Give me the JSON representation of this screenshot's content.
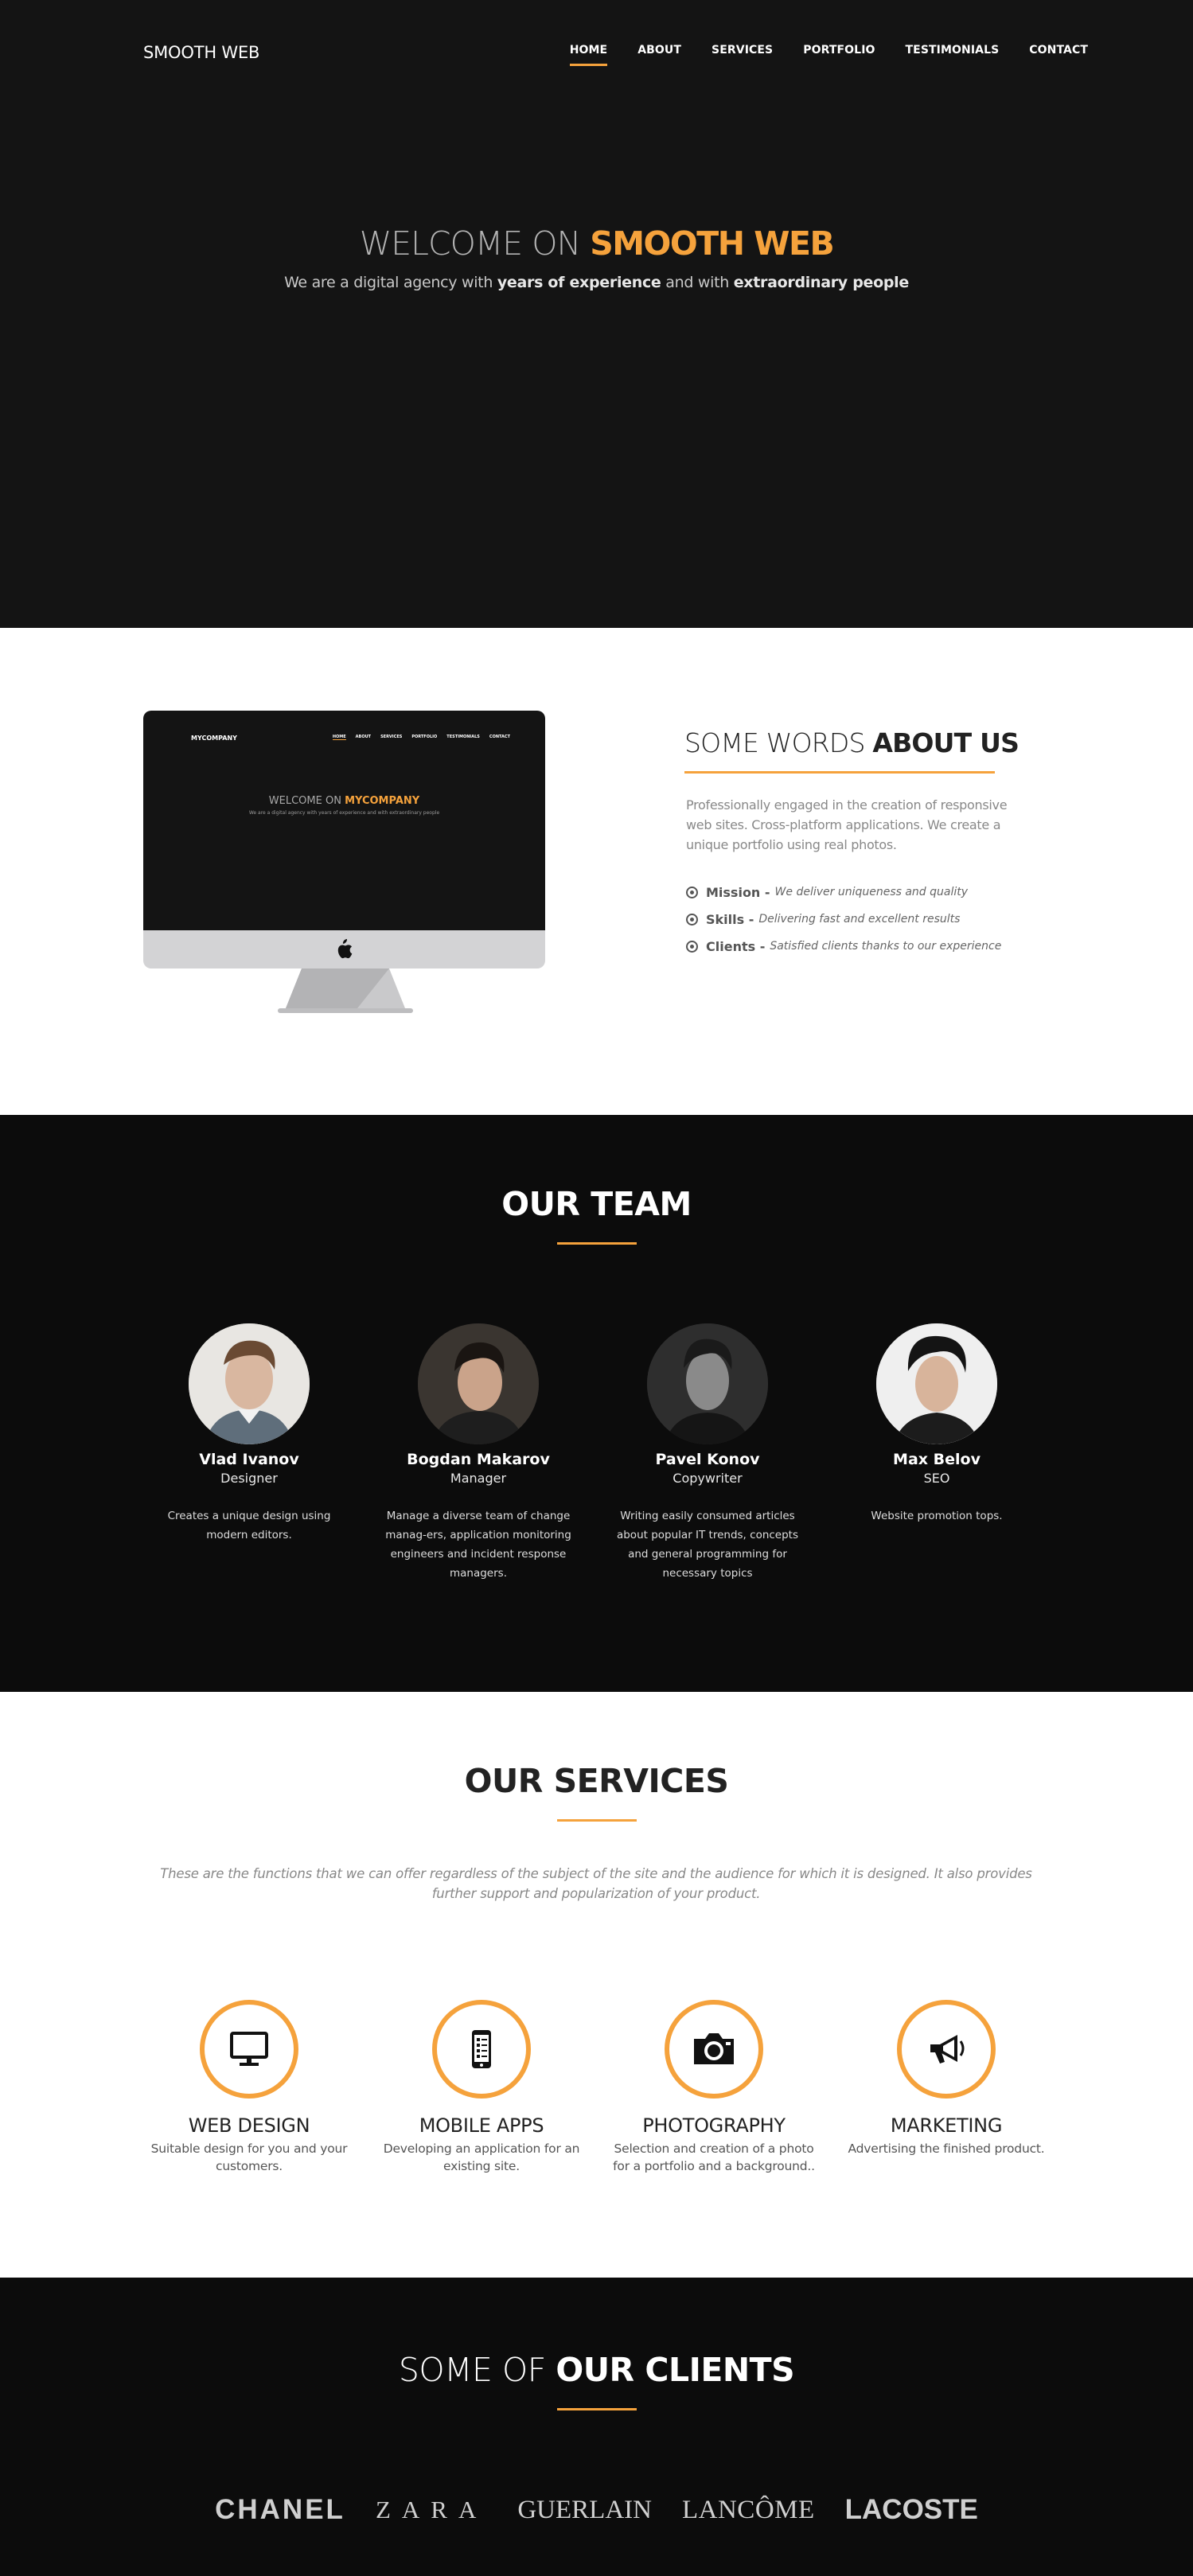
{
  "nav": {
    "logo": "SMOOTH WEB",
    "items": [
      {
        "label": "HOME",
        "active": true
      },
      {
        "label": "ABOUT",
        "active": false
      },
      {
        "label": "SERVICES",
        "active": false
      },
      {
        "label": "PORTFOLIO",
        "active": false
      },
      {
        "label": "TESTIMONIALS",
        "active": false
      },
      {
        "label": "CONTACT",
        "active": false
      }
    ]
  },
  "hero": {
    "title_pre": "WELCOME ON ",
    "title_accent": "SMOOTH WEB",
    "sub_1": "We are a digital agency with ",
    "sub_b1": "years of experience",
    "sub_2": " and with ",
    "sub_b2": "extraordinary people"
  },
  "about": {
    "mockup": {
      "logo": "MYCOMPANY",
      "menu": [
        "HOME",
        "ABOUT",
        "SERVICES",
        "PORTFOLIO",
        "TESTIMONIALS",
        "CONTACT"
      ],
      "title_pre": "WELCOME ON ",
      "title_accent": "MYCOMPANY",
      "sub": "We are a digital agency with years of experience and with extraordinary people"
    },
    "title_pre": "SOME WORDS ",
    "title_bold": "ABOUT US",
    "text": "Professionally engaged in the creation of responsive web sites. Cross-platform applications. We create a unique portfolio using real photos.",
    "list": [
      {
        "label": "Mission -",
        "desc": "We deliver uniqueness and quality"
      },
      {
        "label": "Skills -",
        "desc": "Delivering fast and excellent results"
      },
      {
        "label": "Clients -",
        "desc": "Satisfied clients thanks to our experience"
      }
    ]
  },
  "team": {
    "title": "OUR TEAM",
    "members": [
      {
        "name": "Vlad Ivanov",
        "role": "Designer",
        "desc": "Creates a unique design using modern editors."
      },
      {
        "name": "Bogdan Makarov",
        "role": "Manager",
        "desc": "Manage a diverse team of change manag-ers, application monitoring engineers and incident response managers."
      },
      {
        "name": "Pavel Konov",
        "role": "Copywriter",
        "desc": "Writing easily consumed articles about popular IT trends, concepts and general programming for necessary topics"
      },
      {
        "name": "Max Belov",
        "role": "SEO",
        "desc": "Website promotion tops."
      }
    ]
  },
  "services": {
    "title": "OUR SERVICES",
    "intro": "These are the functions that we can offer regardless of the subject of the site and the audience for which it is designed. It also provides further support and popularization of your product.",
    "items": [
      {
        "icon": "monitor-icon",
        "title": "WEB DESIGN",
        "desc": "Suitable design for you and your customers."
      },
      {
        "icon": "mobile-icon",
        "title": "MOBILE APPS",
        "desc": "Developing an application for an existing site."
      },
      {
        "icon": "camera-icon",
        "title": "PHOTOGRAPHY",
        "desc": "Selection and creation of a photo for a portfolio and a background.."
      },
      {
        "icon": "megaphone-icon",
        "title": "MARKETING",
        "desc": "Advertising the finished product."
      }
    ]
  },
  "clients": {
    "title_pre": "SOME OF ",
    "title_bold": "OUR CLIENTS",
    "logos": [
      "CHANEL",
      "ZARA",
      "GUERLAIN",
      "LANCÔME",
      "LACOSTE"
    ]
  },
  "colors": {
    "accent": "#f5a23c",
    "dark": "#131313"
  }
}
